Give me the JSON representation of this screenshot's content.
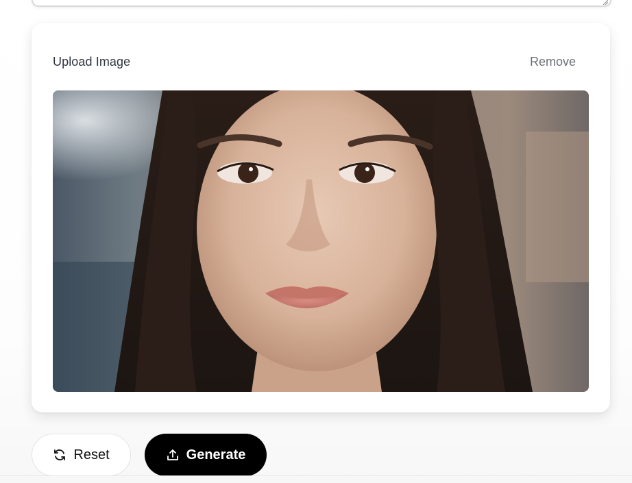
{
  "upload": {
    "label": "Upload Image",
    "remove_label": "Remove"
  },
  "preview": {
    "description_icon": "uploaded-photo"
  },
  "actions": {
    "reset_label": "Reset",
    "reset_icon": "refresh-icon",
    "generate_label": "Generate",
    "generate_icon": "upload-icon"
  },
  "colors": {
    "generate_bg": "#000000",
    "generate_text": "#ffffff",
    "reset_bg": "#ffffff",
    "muted_text": "#6b6f76"
  }
}
